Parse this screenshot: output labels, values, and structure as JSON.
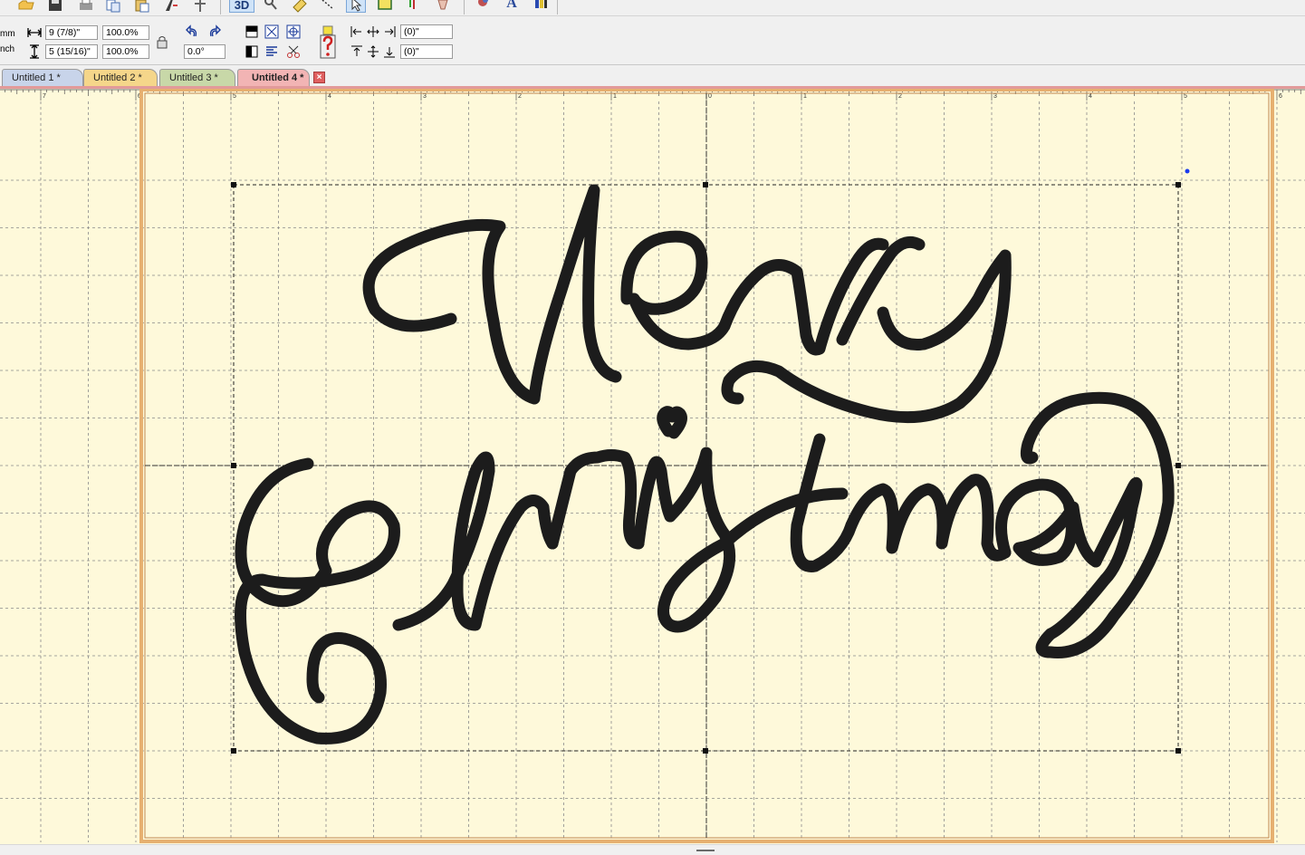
{
  "toolbar": {
    "icons": [
      "open-folder-icon",
      "save-icon",
      "print-icon",
      "copy-icon",
      "paste-icon",
      "design-icon",
      "split-icon",
      "3d-icon",
      "magnify-icon",
      "measure-icon",
      "stitch-icon",
      "pointer-icon",
      "hoop-icon",
      "needle-icon",
      "thread-icon",
      "color-icon",
      "lettering-icon",
      "color-bar-icon"
    ],
    "view_3d_label": "3D",
    "lettering_label": "A"
  },
  "properties": {
    "unit_mm": "mm",
    "unit_inch": "nch",
    "width_value": "9 (7/8)\"",
    "height_value": "5 (15/16)\"",
    "width_scale": "100.0%",
    "height_scale": "100.0%",
    "rotation": "0.0°",
    "offset_x": "(0)\"",
    "offset_y": "(0)\""
  },
  "tabs": [
    {
      "label": "Untitled 1 *",
      "color": "#c8d4ea",
      "active": false
    },
    {
      "label": "Untitled 2 *",
      "color": "#f5d68a",
      "active": false
    },
    {
      "label": "Untitled 3 *",
      "color": "#c8d8a8",
      "active": false
    },
    {
      "label": "Untitled 4 *",
      "color": "#f2b4b4",
      "active": true
    }
  ],
  "ruler": {
    "labels": [
      "7",
      "6",
      "5",
      "4",
      "3",
      "2",
      "1",
      "0",
      "1",
      "2",
      "3",
      "4",
      "5",
      "6"
    ]
  },
  "design": {
    "line1": "Merry",
    "line2": "Christmas",
    "thread_color": "#1c1c1c"
  },
  "colors": {
    "canvas_bg": "#fef9da",
    "hoop_border": "#e6b070",
    "grid_line": "#8a8a8a",
    "tab_accent": "#e29a9a"
  }
}
